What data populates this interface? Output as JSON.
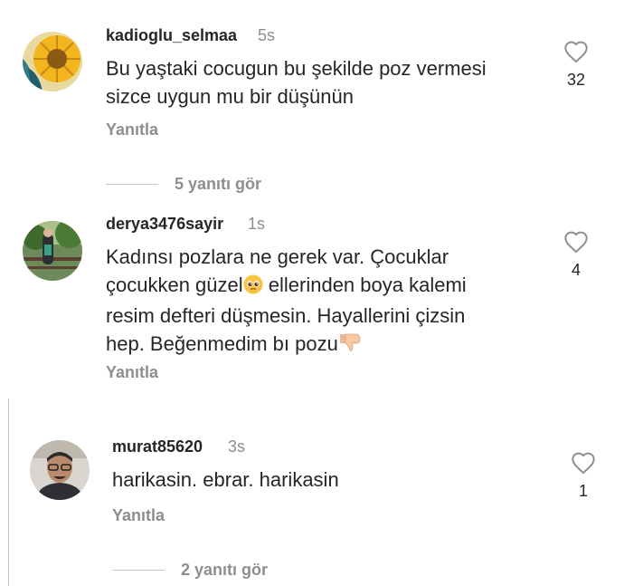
{
  "comments": [
    {
      "username": "kadioglu_selmaa",
      "time": "5s",
      "text": "Bu yaştaki cocugun bu şekilde poz vermesi sizce uygun mu bir düşünün",
      "text_lines": [
        "Bu yaştaki cocugun bu şekilde poz vermesi",
        "sizce uygun mu bir düşünün"
      ],
      "likes": "32",
      "reply_label": "Yanıtla",
      "view_replies": "5 yanıtı gör"
    },
    {
      "username": "derya3476sayir",
      "time": "1s",
      "text_lines": [
        "Kadınsı pozlara ne gerek var. Çocuklar",
        "çocukken güzel",
        " ellerinden boya kalemi",
        "resim defteri düşmesin.  Hayallerini çizsin",
        "hep. Beğenmedim bı pozu"
      ],
      "likes": "4",
      "reply_label": "Yanıtla"
    },
    {
      "username": "murat85620",
      "time": "3s",
      "text": "harikasin. ebrar.  harikasin",
      "likes": "1",
      "reply_label": "Yanıtla",
      "view_replies": "2 yanıtı gör"
    }
  ],
  "icons": {
    "like": "heart-outline-icon",
    "emoji_pleading": "pleading-face-emoji",
    "emoji_thumbs_down": "thumbs-down-emoji"
  },
  "colors": {
    "text": "#262626",
    "secondary": "#8e8e8e",
    "divider": "#c7c7c7"
  }
}
